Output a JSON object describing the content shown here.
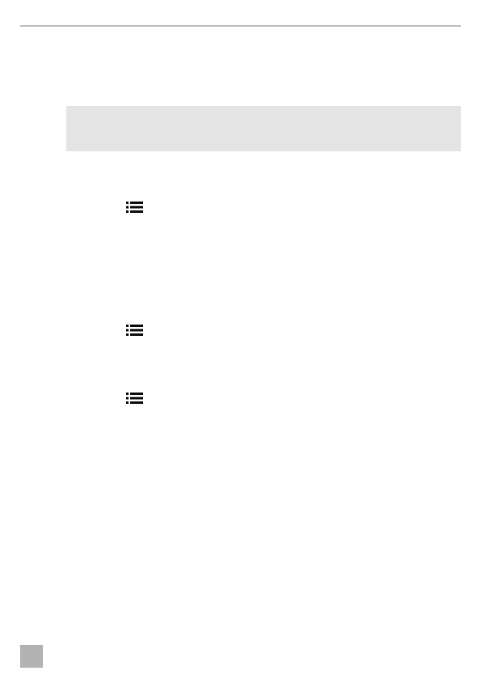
{
  "document": {
    "colors": {
      "rule": "#bdbdbd",
      "note_box": "#e4e4e4",
      "page_marker": "#b3b3b3",
      "icon": "#111111"
    },
    "icons": [
      "list-icon",
      "list-icon",
      "list-icon"
    ]
  }
}
